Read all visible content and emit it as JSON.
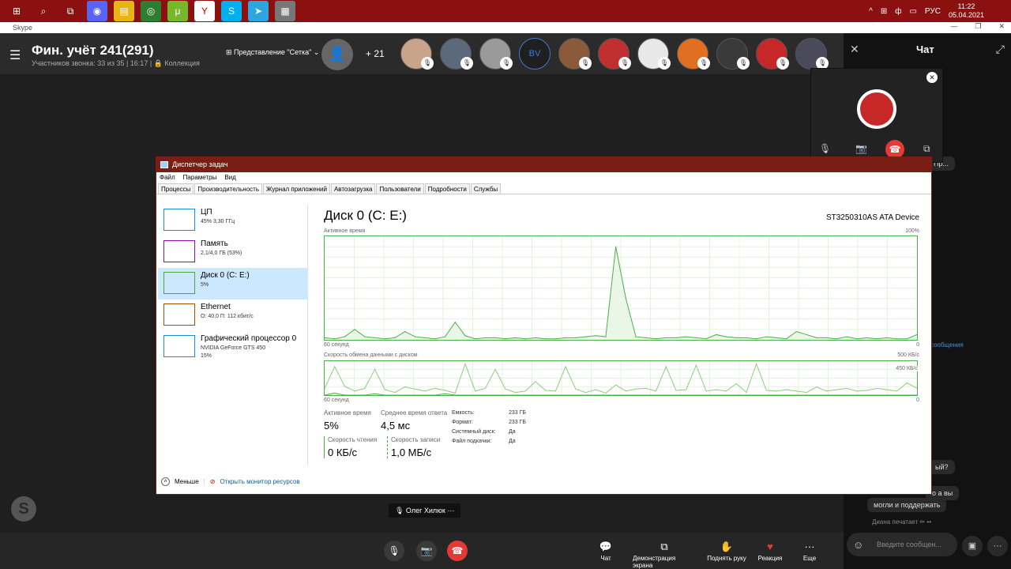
{
  "taskbar": {
    "lang": "РУС",
    "time": "11:22",
    "date": "05.04.2021",
    "tray": [
      "^",
      "⊞",
      "ф",
      "▭"
    ],
    "apps": [
      {
        "icon": "windows-start-icon",
        "glyph": "⊞",
        "color": "transparent"
      },
      {
        "icon": "search-icon",
        "glyph": "⌕",
        "color": "transparent"
      },
      {
        "icon": "task-view-icon",
        "glyph": "⧉",
        "color": "transparent"
      },
      {
        "icon": "discord-icon",
        "glyph": "◉",
        "color": "#5865f2"
      },
      {
        "icon": "explorer-icon",
        "glyph": "▤",
        "color": "#e7b416"
      },
      {
        "icon": "chrome-icon",
        "glyph": "◎",
        "color": "#2e7d32"
      },
      {
        "icon": "utorrent-icon",
        "glyph": "μ",
        "color": "#76b82a"
      },
      {
        "icon": "yandex-icon",
        "glyph": "Y",
        "color": "#fff"
      },
      {
        "icon": "skype-icon",
        "glyph": "S",
        "color": "#00aff0"
      },
      {
        "icon": "telegram-icon",
        "glyph": "➤",
        "color": "#2ca5e0"
      },
      {
        "icon": "task-manager-icon",
        "glyph": "▦",
        "color": "#777"
      }
    ]
  },
  "skype": {
    "window_title": "Skype",
    "title": "Фин. учёт 241(291)",
    "subtitle": "Участников звонка: 33 из 35 | 16:17 | 🔒 Коллекция",
    "grid_view": "⊞ Представление \"Сетка\" ⌄",
    "more_count": "+ 21",
    "speaker": "🎙 Олег Хилюк ···",
    "avatars": [
      {
        "color": "#c9a48a"
      },
      {
        "color": "#5a6a7a"
      },
      {
        "color": "#9a9a9a"
      },
      {
        "text": "BV"
      },
      {
        "color": "#8a5a3a"
      },
      {
        "color": "#c03030"
      },
      {
        "color": "#e8e8e8"
      },
      {
        "color": "#e07020"
      },
      {
        "color": "#3a3a3a"
      },
      {
        "color": "#c62828"
      },
      {
        "color": "#4a4a5a"
      }
    ],
    "controls": [
      {
        "label": "Чат",
        "glyph": "💬",
        "x": 727
      },
      {
        "label": "Демонстрация экрана",
        "glyph": "⧉",
        "x": 801
      },
      {
        "label": "Поднять руку",
        "glyph": "✋",
        "x": 880
      },
      {
        "label": "Реакция",
        "glyph": "♥",
        "x": 935
      },
      {
        "label": "Еще",
        "glyph": "···",
        "x": 985
      }
    ]
  },
  "chat": {
    "title": "Чат",
    "placeholder": "Введите сообщен...",
    "typing": "Диана печатает ✏ ••",
    "bubbles": [
      {
        "text": "Пр...",
        "x": 106,
        "y": 156
      },
      {
        "text": "ый?",
        "x": 108,
        "y": 540
      },
      {
        "text": "о а вы",
        "x": 104,
        "y": 573
      },
      {
        "text": "могли и поддержать",
        "x": 30,
        "y": 588
      }
    ],
    "link": "сообщения"
  },
  "taskmgr": {
    "title": "Диспетчер задач",
    "menu": [
      "Файл",
      "Параметры",
      "Вид"
    ],
    "tabs": [
      "Процессы",
      "Производительность",
      "Журнал приложений",
      "Автозагрузка",
      "Пользователи",
      "Подробности",
      "Службы"
    ],
    "resources": [
      {
        "name": "ЦП",
        "sub": "45% 3,30 ГГц",
        "sub2": ""
      },
      {
        "name": "Память",
        "sub": "2,1/4,0 ГБ (53%)",
        "sub2": ""
      },
      {
        "name": "Диск 0 (C: E:)",
        "sub": "5%",
        "sub2": ""
      },
      {
        "name": "Ethernet",
        "sub": "О: 40,0 П: 112 кбит/с",
        "sub2": ""
      },
      {
        "name": "Графический процессор 0",
        "sub": "NVIDIA GeForce GTS 450",
        "sub2": "15%"
      }
    ],
    "disk_title": "Диск 0 (C: E:)",
    "disk_model": "ST3250310AS ATA Device",
    "active_time_label": "Активное время",
    "max_100": "100%",
    "sixty_sec": "60 секунд",
    "zero": "0",
    "transfer_label": "Скорость обмена данными с диском",
    "max_500": "500 КБ/с",
    "sixty_sec2": "60 секунд",
    "zero2": "0",
    "mark_450": "450 КБ/с",
    "stats": {
      "active_label": "Активное время",
      "active_val": "5%",
      "resp_label": "Среднее время ответа",
      "resp_val": "4,5 мс",
      "read_label": "Скорость чтения",
      "read_val": "0 КБ/с",
      "write_label": "Скорость записи",
      "write_val": "1,0 МБ/с"
    },
    "props": [
      {
        "k": "Емкость:",
        "v": "233 ГБ"
      },
      {
        "k": "Формат:",
        "v": "233 ГБ"
      },
      {
        "k": "Системный диск:",
        "v": "Да"
      },
      {
        "k": "Файл подкачки:",
        "v": "Да"
      }
    ],
    "fewer": "Меньше",
    "resmon": "Открыть монитор ресурсов"
  },
  "chart_data": [
    {
      "type": "area",
      "title": "Активное время",
      "ylim": [
        0,
        100
      ],
      "x": [
        "60 секунд",
        "0"
      ],
      "values": [
        2,
        1,
        3,
        10,
        3,
        2,
        1,
        2,
        8,
        3,
        2,
        1,
        3,
        17,
        4,
        1,
        2,
        2,
        1,
        2,
        1,
        2,
        1,
        1,
        2,
        2,
        3,
        4,
        3,
        90,
        40,
        3,
        2,
        1,
        2,
        2,
        3,
        2,
        1,
        5,
        3,
        2,
        2,
        1,
        3,
        2,
        1,
        8,
        5,
        2,
        2,
        1,
        3,
        1,
        2,
        1,
        2,
        1,
        1,
        5
      ]
    },
    {
      "type": "line",
      "title": "Скорость обмена данными с диском",
      "ylim": [
        0,
        500
      ],
      "series": [
        {
          "values": [
            100,
            420,
            130,
            60,
            100,
            380,
            80,
            40,
            120,
            90,
            60,
            100,
            70,
            30,
            460,
            60,
            100,
            380,
            90,
            40,
            60,
            200,
            70,
            60,
            420,
            90,
            40,
            80,
            30,
            150,
            60,
            90,
            100,
            60,
            420,
            70,
            80,
            440,
            60,
            80,
            60,
            170,
            40,
            460,
            70,
            60,
            80,
            60,
            40,
            120,
            60,
            80,
            100,
            60,
            70,
            100,
            80,
            60,
            180,
            100
          ]
        },
        {
          "values": [
            0,
            30,
            0,
            0,
            0,
            20,
            0,
            0,
            0,
            0,
            0,
            0,
            20,
            0,
            0,
            0,
            0,
            0,
            0,
            0,
            0,
            0,
            0,
            0,
            0,
            0,
            0,
            0,
            0,
            0,
            0,
            0,
            0,
            0,
            0,
            0,
            0,
            0,
            0,
            0,
            0,
            0,
            0,
            0,
            0,
            0,
            0,
            0,
            0,
            0,
            0,
            0,
            0,
            0,
            0,
            0,
            0,
            0,
            0,
            0
          ]
        }
      ]
    }
  ]
}
